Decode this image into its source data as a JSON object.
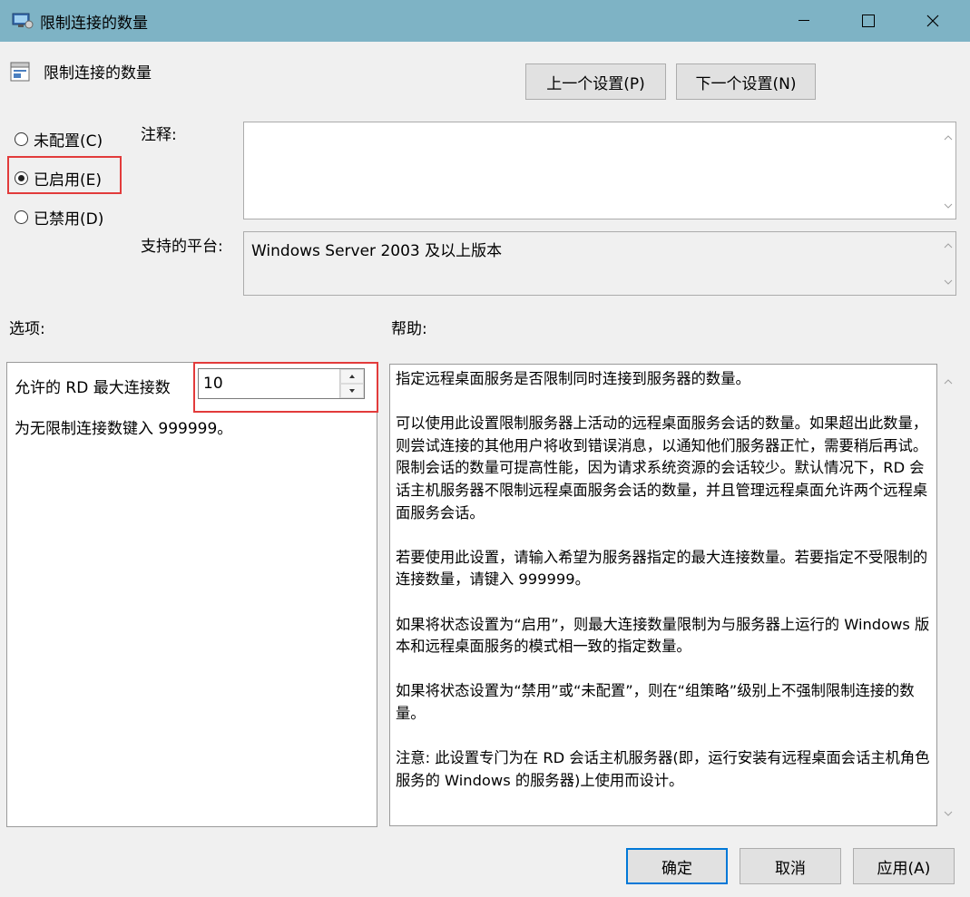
{
  "window": {
    "title": "限制连接的数量"
  },
  "header": {
    "title": "限制连接的数量"
  },
  "nav": {
    "prev_label": "上一个设置(P)",
    "next_label": "下一个设置(N)"
  },
  "state": {
    "options": [
      {
        "label": "未配置(C)",
        "selected": false
      },
      {
        "label": "已启用(E)",
        "selected": true
      },
      {
        "label": "已禁用(D)",
        "selected": false
      }
    ]
  },
  "comment": {
    "label": "注释:",
    "value": ""
  },
  "platform": {
    "label": "支持的平台:",
    "value": "Windows Server 2003 及以上版本"
  },
  "options_section": {
    "label": "选项:",
    "max_connections_label": "允许的 RD 最大连接数",
    "max_connections_value": "10",
    "hint": "为无限制连接数键入 999999。"
  },
  "help_section": {
    "label": "帮助:",
    "paragraphs": [
      "指定远程桌面服务是否限制同时连接到服务器的数量。",
      "可以使用此设置限制服务器上活动的远程桌面服务会话的数量。如果超出此数量，则尝试连接的其他用户将收到错误消息，以通知他们服务器正忙，需要稍后再试。限制会话的数量可提高性能，因为请求系统资源的会话较少。默认情况下，RD 会话主机服务器不限制远程桌面服务会话的数量，并且管理远程桌面允许两个远程桌面服务会话。",
      "若要使用此设置，请输入希望为服务器指定的最大连接数量。若要指定不受限制的连接数量，请键入 999999。",
      "如果将状态设置为“启用”，则最大连接数量限制为与服务器上运行的 Windows 版本和远程桌面服务的模式相一致的指定数量。",
      "如果将状态设置为“禁用”或“未配置”，则在“组策略”级别上不强制限制连接的数量。",
      "注意: 此设置专门为在 RD 会话主机服务器(即，运行安装有远程桌面会话主机角色服务的 Windows 的服务器)上使用而设计。"
    ]
  },
  "footer": {
    "ok_label": "确定",
    "cancel_label": "取消",
    "apply_label": "应用(A)"
  },
  "colors": {
    "titlebar": "#7eb3c5",
    "highlight": "#e23b3b",
    "default_button_border": "#0078d7"
  }
}
